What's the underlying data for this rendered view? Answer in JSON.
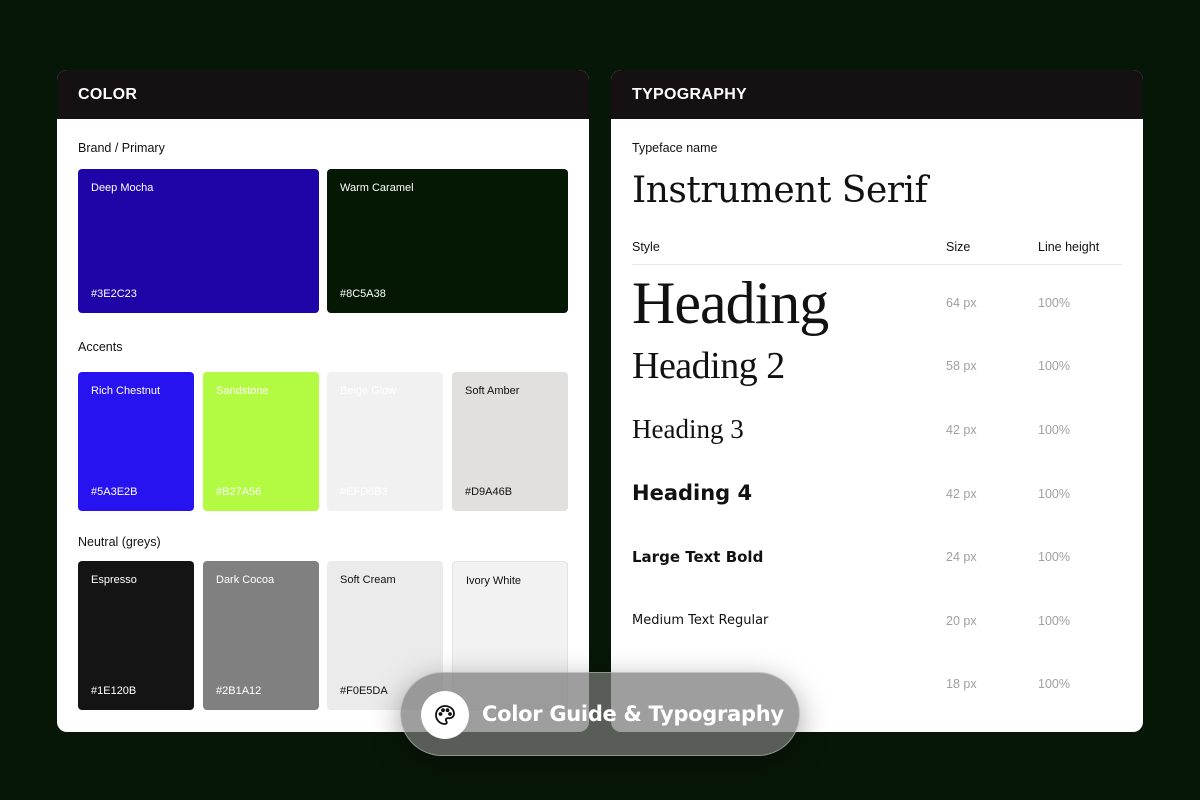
{
  "color_panel": {
    "title": "COLOR",
    "brand": {
      "label": "Brand / Primary",
      "swatches": [
        {
          "name": "Deep Mocha",
          "hex_label": "#3E2C23",
          "fill": "#1f05a8",
          "text": "#ffffff"
        },
        {
          "name": "Warm Caramel",
          "hex_label": "#8C5A38",
          "fill": "#041804",
          "text": "#ffffff"
        }
      ]
    },
    "accents": {
      "label": "Accents",
      "swatches": [
        {
          "name": "Rich Chestnut",
          "hex_label": "#5A3E2B",
          "fill": "#2712f0",
          "text": "#ffffff"
        },
        {
          "name": "Sandstone",
          "hex_label": "#B27A56",
          "fill": "#b3fb42",
          "text": "#ffffff"
        },
        {
          "name": "Beige Glow",
          "hex_label": "#EFD6B3",
          "fill": "#f1f1f1",
          "text": "#ffffff"
        },
        {
          "name": "Soft Amber",
          "hex_label": "#D9A46B",
          "fill": "#e1e0df",
          "text": "#111111"
        }
      ]
    },
    "neutral": {
      "label": "Neutral (greys)",
      "swatches": [
        {
          "name": "Espresso",
          "hex_label": "#1E120B",
          "fill": "#141414",
          "text": "#ffffff"
        },
        {
          "name": "Dark Cocoa",
          "hex_label": "#2B1A12",
          "fill": "#808080",
          "text": "#ffffff"
        },
        {
          "name": "Soft Cream",
          "hex_label": "#F0E5DA",
          "fill": "#ebebeb",
          "text": "#111111"
        },
        {
          "name": "Ivory White",
          "hex_label": "",
          "fill": "#f2f2f2",
          "text": "#111111"
        }
      ]
    }
  },
  "typography_panel": {
    "title": "TYPOGRAPHY",
    "typeface_label": "Typeface name",
    "typeface_name": "Instrument Serif",
    "columns": {
      "style": "Style",
      "size": "Size",
      "line_height": "Line height"
    },
    "styles": [
      {
        "name": "Heading",
        "size": "64 px",
        "line_height": "100%"
      },
      {
        "name": "Heading 2",
        "size": "58 px",
        "line_height": "100%"
      },
      {
        "name": "Heading 3",
        "size": "42 px",
        "line_height": "100%"
      },
      {
        "name": "Heading 4",
        "size": "42 px",
        "line_height": "100%"
      },
      {
        "name": "Large Text Bold",
        "size": "24 px",
        "line_height": "100%"
      },
      {
        "name": "Medium Text Regular",
        "size": "20 px",
        "line_height": "100%"
      },
      {
        "name": "",
        "size": "18 px",
        "line_height": "100%"
      }
    ]
  },
  "badge": {
    "label": "Color Guide & Typography",
    "icon": "palette-icon"
  }
}
